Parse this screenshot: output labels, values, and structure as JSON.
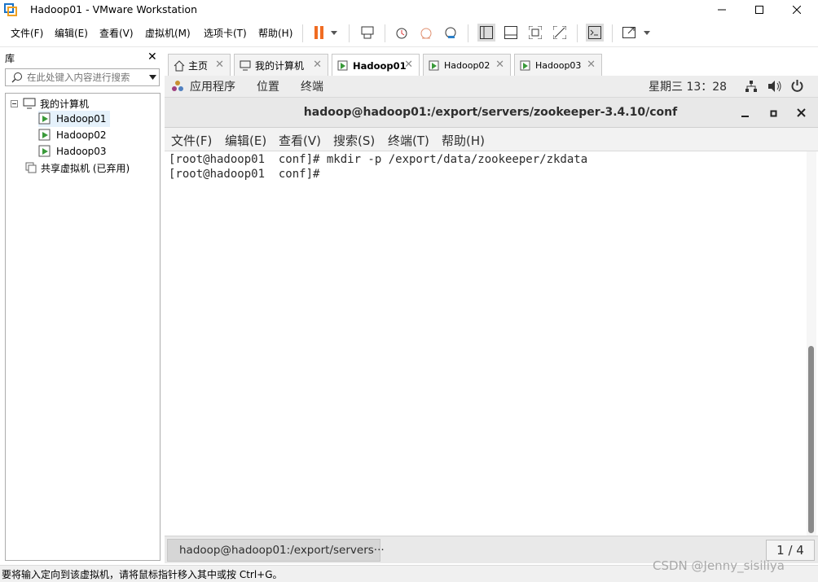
{
  "window": {
    "title": "Hadoop01 - VMware Workstation"
  },
  "menu": [
    {
      "label": "文件(F)"
    },
    {
      "label": "编辑(E)"
    },
    {
      "label": "查看(V)"
    },
    {
      "label": "虚拟机(M)"
    },
    {
      "label": "选项卡(T)"
    },
    {
      "label": "帮助(H)"
    }
  ],
  "library": {
    "title": "库",
    "search_placeholder": "在此处键入内容进行搜索",
    "tree": [
      {
        "label": "我的计算机"
      },
      {
        "label": "Hadoop01"
      },
      {
        "label": "Hadoop02"
      },
      {
        "label": "Hadoop03"
      },
      {
        "label": "共享虚拟机 (已弃用)"
      }
    ]
  },
  "tabs": [
    {
      "label": "主页"
    },
    {
      "label": "我的计算机"
    },
    {
      "label": "Hadoop01"
    },
    {
      "label": "Hadoop02"
    },
    {
      "label": "Hadoop03"
    }
  ],
  "vm": {
    "topbar": {
      "apps": "应用程序",
      "places": "位置",
      "terminal": "终端",
      "clock": "星期三 13：28"
    },
    "terminal_title": "hadoop@hadoop01:/export/servers/zookeeper-3.4.10/conf",
    "terminal_menu": [
      {
        "label": "文件(F)"
      },
      {
        "label": "编辑(E)"
      },
      {
        "label": "查看(V)"
      },
      {
        "label": "搜索(S)"
      },
      {
        "label": "终端(T)"
      },
      {
        "label": "帮助(H)"
      }
    ],
    "lines": [
      "[root@hadoop01  conf]# mkdir -p /export/data/zookeeper/zkdata",
      "[root@hadoop01  conf]# "
    ],
    "taskbar_item": "hadoop@hadoop01:/export/servers···",
    "pager": "1 / 4"
  },
  "status": {
    "text": "要将输入定向到该虚拟机，请将鼠标指针移入其中或按 Ctrl+G。",
    "watermark": "CSDN @Jenny_sisiliya"
  },
  "colors": {
    "pause": "#f06c22",
    "vm_play": "#3a9a3a"
  }
}
